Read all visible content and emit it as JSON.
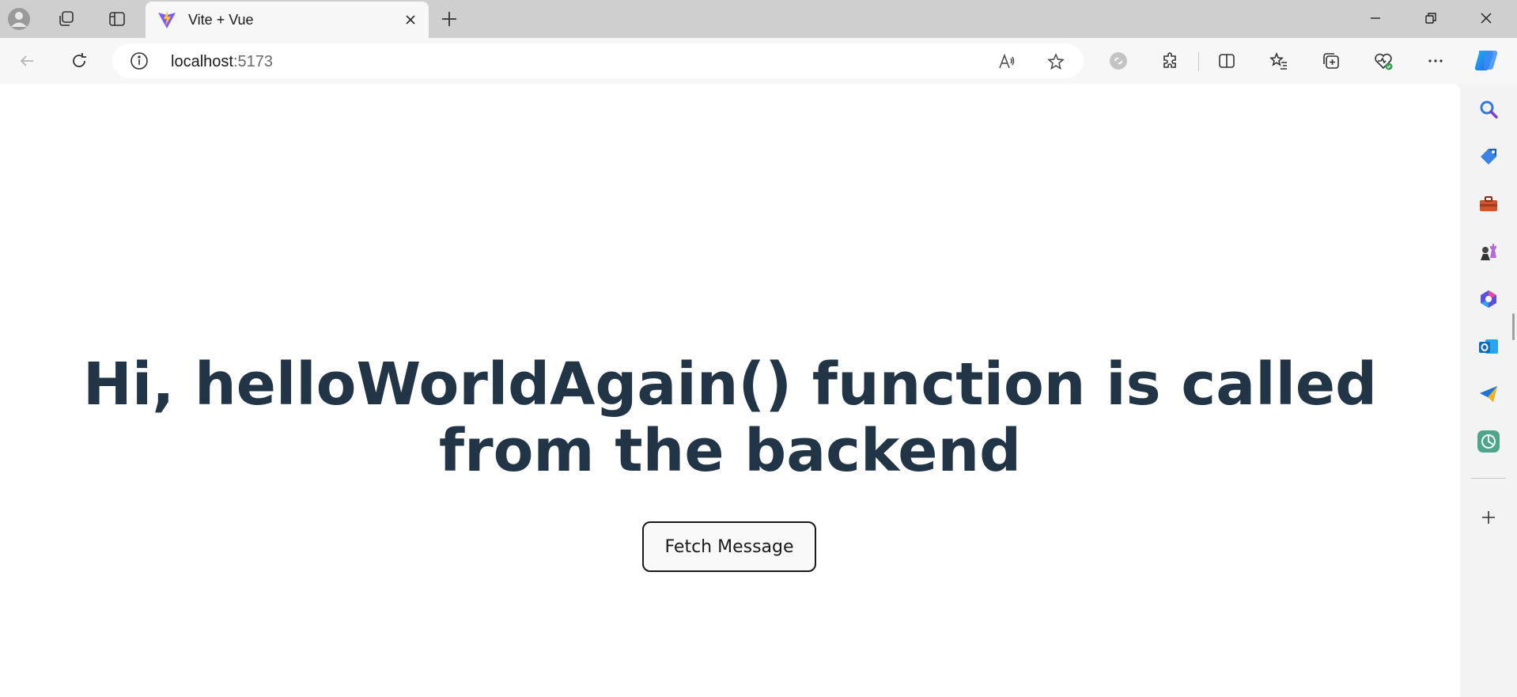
{
  "browser": {
    "tab": {
      "title": "Vite + Vue"
    },
    "address": {
      "host": "localhost",
      "port": ":5173"
    }
  },
  "page": {
    "heading": "Hi, helloWorldAgain() function is called from the backend",
    "button_label": "Fetch Message"
  },
  "icons": {
    "tabbar": [
      "profile-icon",
      "workspaces-icon",
      "vertical-tabs-icon",
      "close-icon",
      "new-tab-icon",
      "minimize-icon",
      "restore-icon",
      "close-window-icon"
    ],
    "toolbar": [
      "back-icon",
      "refresh-icon",
      "info-icon",
      "read-aloud-icon",
      "favorite-star-icon",
      "extension-icon",
      "extensions-icon",
      "split-screen-icon",
      "favorites-icon",
      "collections-icon",
      "browser-essentials-icon",
      "more-icon",
      "copilot-icon"
    ],
    "sidebar": [
      "search-icon",
      "shopping-icon",
      "tools-icon",
      "games-icon",
      "microsoft-365-icon",
      "outlook-icon",
      "telegram-icon",
      "chatgpt-icon",
      "add-icon"
    ]
  },
  "colors": {
    "heading": "#213547",
    "tabbar": "#cfcfcf",
    "page_bg": "#ffffff"
  }
}
